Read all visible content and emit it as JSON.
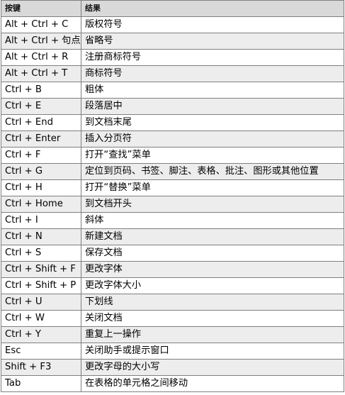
{
  "header": {
    "col_keys": "按键",
    "col_result": "结果"
  },
  "rows": [
    {
      "keys": "Alt + Ctrl + C",
      "result": "版权符号"
    },
    {
      "keys": "Alt + Ctrl + 句点",
      "result": "省略号"
    },
    {
      "keys": "Alt + Ctrl + R",
      "result": "注册商标符号"
    },
    {
      "keys": "Alt + Ctrl + T",
      "result": "商标符号"
    },
    {
      "keys": "Ctrl + B",
      "result": "粗体"
    },
    {
      "keys": "Ctrl + E",
      "result": "段落居中"
    },
    {
      "keys": "Ctrl + End",
      "result": "到文档末尾"
    },
    {
      "keys": "Ctrl + Enter",
      "result": "插入分页符"
    },
    {
      "keys": "Ctrl + F",
      "result": "打开“查找”菜单"
    },
    {
      "keys": "Ctrl + G",
      "result": "定位到页码、书签、脚注、表格、批注、图形或其他位置"
    },
    {
      "keys": "Ctrl + H",
      "result": "打开“替换”菜单"
    },
    {
      "keys": "Ctrl + Home",
      "result": "到文档开头"
    },
    {
      "keys": "Ctrl + I",
      "result": "斜体"
    },
    {
      "keys": "Ctrl + N",
      "result": "新建文档"
    },
    {
      "keys": "Ctrl + S",
      "result": "保存文档"
    },
    {
      "keys": "Ctrl + Shift + F",
      "result": "更改字体"
    },
    {
      "keys": "Ctrl + Shift + P",
      "result": "更改字体大小"
    },
    {
      "keys": "Ctrl + U",
      "result": "下划线"
    },
    {
      "keys": "Ctrl + W",
      "result": "关闭文档"
    },
    {
      "keys": "Ctrl + Y",
      "result": "重复上一操作"
    },
    {
      "keys": "Esc",
      "result": "关闭助手或提示窗口"
    },
    {
      "keys": "Shift + F3",
      "result": "更改字母的大小写"
    },
    {
      "keys": "Tab",
      "result": "在表格的单元格之间移动"
    }
  ]
}
